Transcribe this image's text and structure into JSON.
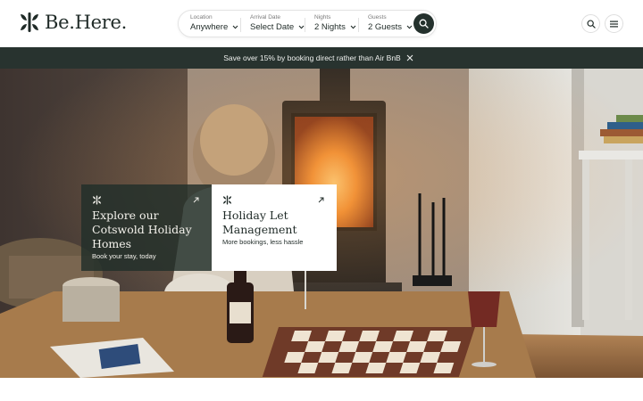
{
  "brand": {
    "name": "Be.Here."
  },
  "search": {
    "location": {
      "label": "Location",
      "value": "Anywhere"
    },
    "arrival": {
      "label": "Arrival Date",
      "value": "Select Date"
    },
    "nights": {
      "label": "Nights",
      "value": "2 Nights"
    },
    "guests": {
      "label": "Guests",
      "value": "2 Guests"
    }
  },
  "icons": {
    "search": "search-icon",
    "menu": "hamburger-menu-icon",
    "close": "close-icon",
    "chevron": "chevron-down-icon",
    "arrow": "arrow-up-right-icon"
  },
  "promo": {
    "text": "Save over 15% by booking direct rather than Air BnB"
  },
  "cards": [
    {
      "title": "Explore our Cotswold Holiday Homes",
      "subtitle": "Book your stay, today"
    },
    {
      "title": "Holiday Let Management",
      "subtitle": "More bookings, less hassle"
    }
  ],
  "colors": {
    "brand_dark": "#24312d",
    "promo_bg": "#28332f",
    "card_dark": "#212e29",
    "card_light": "#ffffff"
  }
}
